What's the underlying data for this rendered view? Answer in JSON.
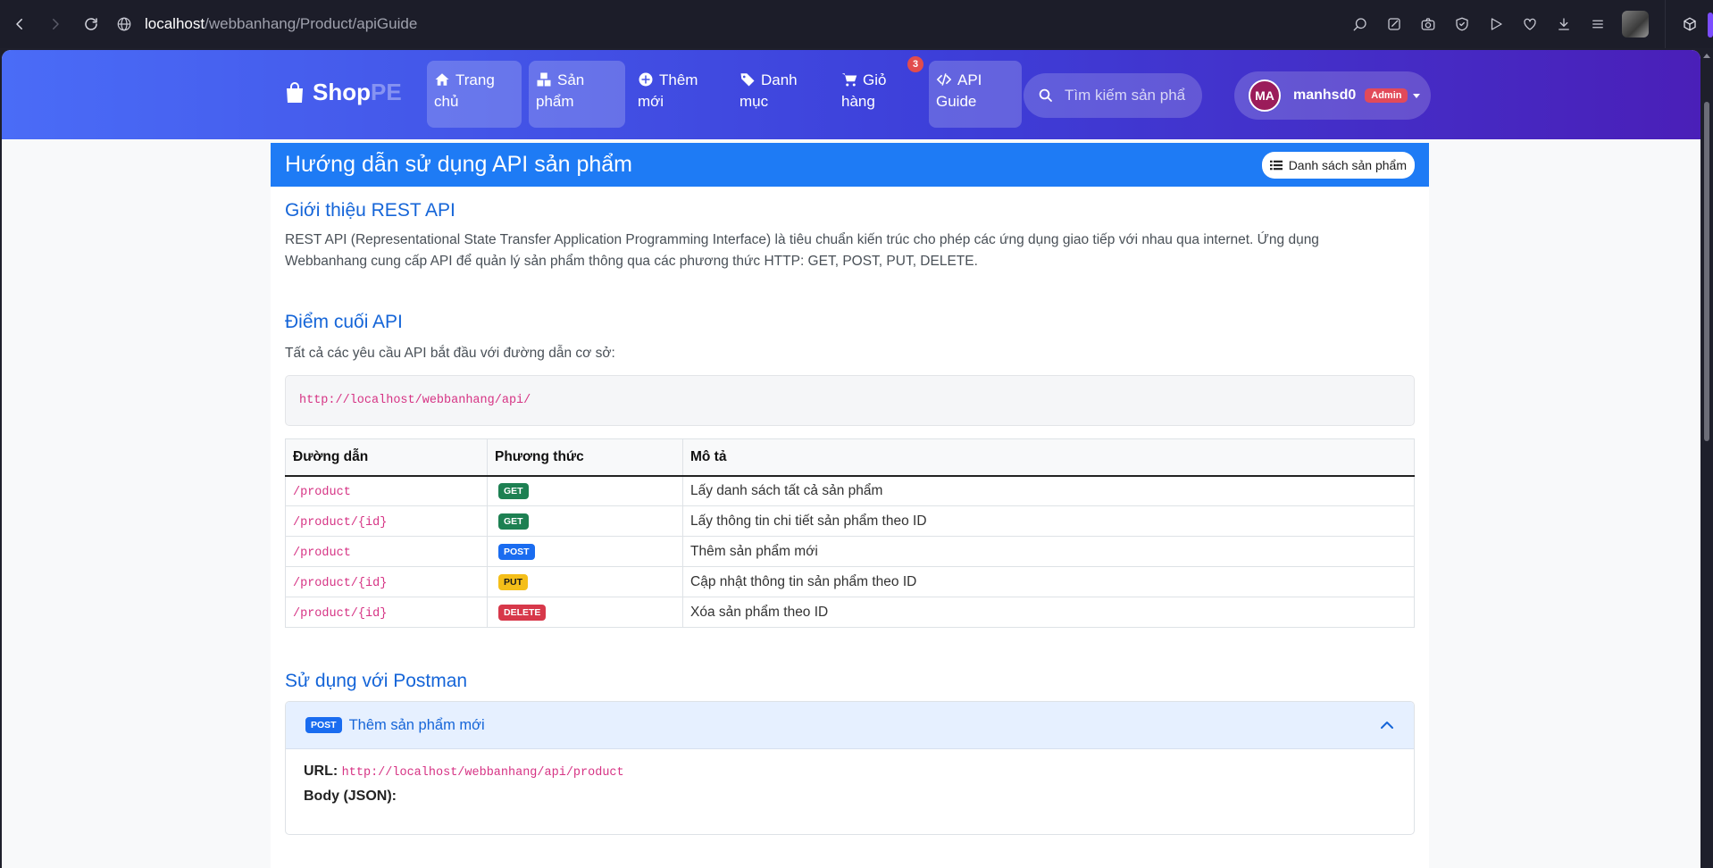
{
  "browser": {
    "url_host": "localhost",
    "url_path": "/webbanhang/Product/apiGuide"
  },
  "navbar": {
    "brand_shop": "Shop",
    "brand_pe": "PE",
    "items": [
      {
        "line1": "Trang",
        "line2": "chủ",
        "icon": "home-icon"
      },
      {
        "line1": "Sản",
        "line2": "phẩm",
        "icon": "boxes-icon"
      },
      {
        "line1": "Thêm",
        "line2": "mới",
        "icon": "plus-circle-icon"
      },
      {
        "line1": "Danh",
        "line2": "mục",
        "icon": "tags-icon"
      },
      {
        "line1": "Giỏ",
        "line2": "hàng",
        "icon": "cart-icon"
      },
      {
        "line1": "API",
        "line2": "Guide",
        "icon": "code-icon"
      }
    ],
    "cart_count": "3",
    "search_placeholder": "Tìm kiếm sản phẩ",
    "user_initials": "MA",
    "username": "manhsd0",
    "role": "Admin"
  },
  "card": {
    "title": "Hướng dẫn sử dụng API sản phẩm",
    "list_button": "Danh sách sản phẩm"
  },
  "intro": {
    "title": "Giới thiệu REST API",
    "line1": "REST API (Representational State Transfer Application Programming Interface) là tiêu chuẩn kiến trúc cho phép các ứng dụng giao tiếp với nhau qua internet. Ứng dụng",
    "line2": "Webbanhang cung cấp API để quản lý sản phẩm thông qua các phương thức HTTP: GET, POST, PUT, DELETE."
  },
  "endpoints": {
    "title": "Điểm cuối API",
    "lead": "Tất cả các yêu cầu API bắt đầu với đường dẫn cơ sở:",
    "base_url": "http://localhost/webbanhang/api/",
    "headers": [
      "Đường dẫn",
      "Phương thức",
      "Mô tả"
    ],
    "rows": [
      {
        "path": "/product",
        "method": "GET",
        "desc": "Lấy danh sách tất cả sản phẩm"
      },
      {
        "path": "/product/{id}",
        "method": "GET",
        "desc": "Lấy thông tin chi tiết sản phẩm theo ID"
      },
      {
        "path": "/product",
        "method": "POST",
        "desc": "Thêm sản phẩm mới"
      },
      {
        "path": "/product/{id}",
        "method": "PUT",
        "desc": "Cập nhật thông tin sản phẩm theo ID"
      },
      {
        "path": "/product/{id}",
        "method": "DELETE",
        "desc": "Xóa sản phẩm theo ID"
      }
    ]
  },
  "postman": {
    "title": "Sử dụng với Postman",
    "accordion": {
      "method": "POST",
      "title": "Thêm sản phẩm mới",
      "url_label": "URL:",
      "url": "http://localhost/webbanhang/api/product",
      "body_label": "Body (JSON):"
    }
  },
  "colors": {
    "primary": "#1e7bf5",
    "heading": "#1565d8",
    "get": "#1d8052",
    "post": "#1a6cf0",
    "put": "#f4be19",
    "delete": "#d7384a",
    "code": "#d63384"
  }
}
